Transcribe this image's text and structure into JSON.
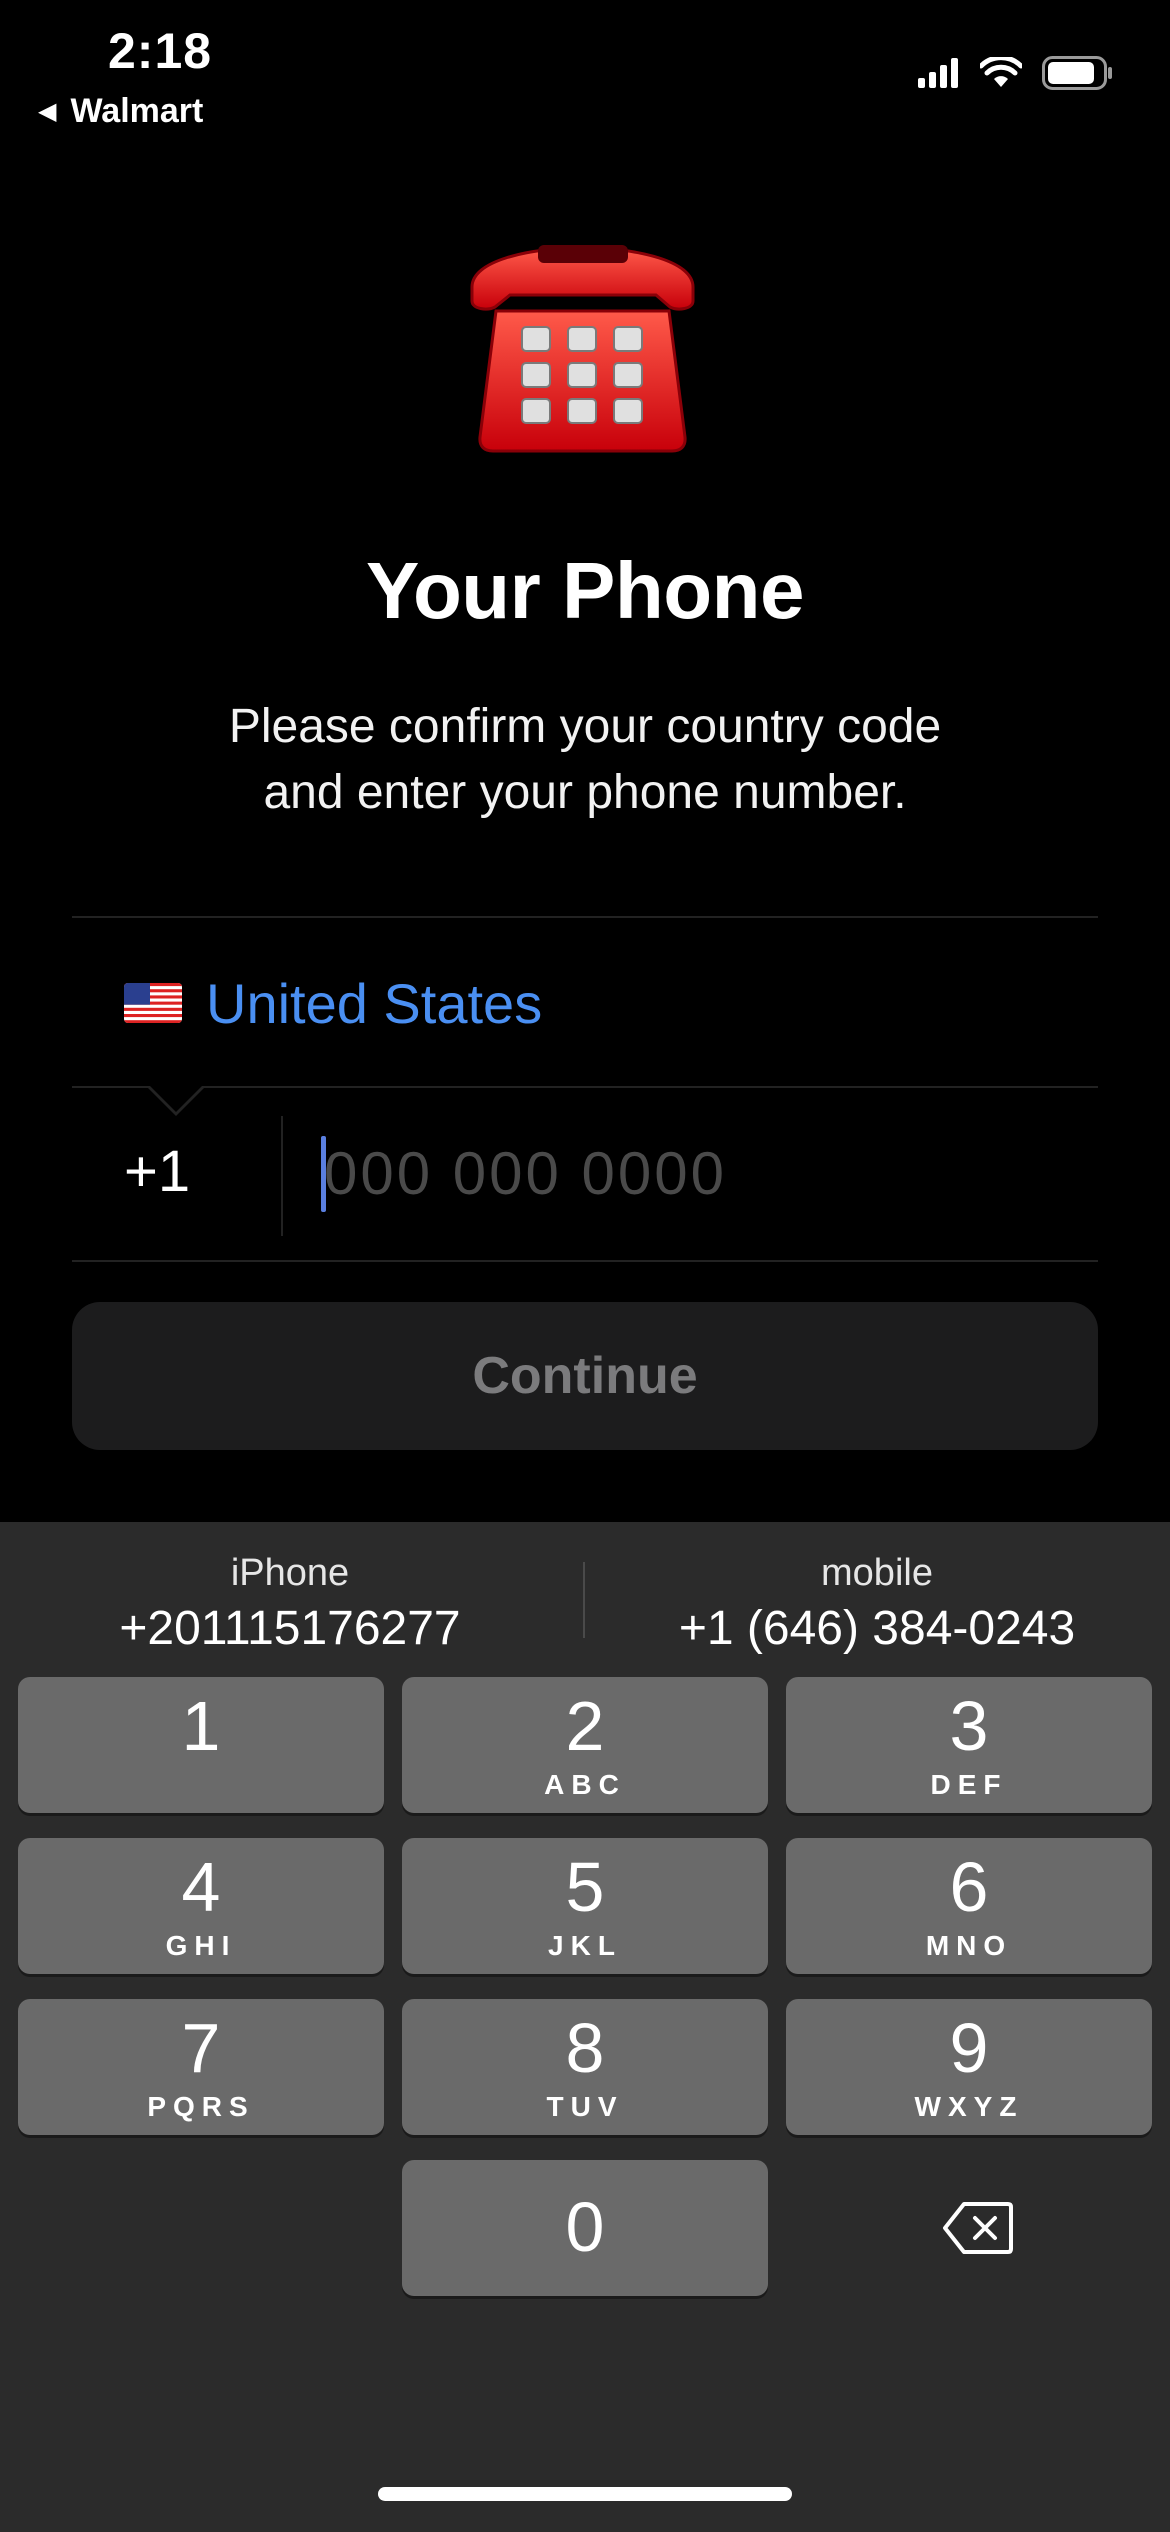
{
  "status_bar": {
    "time": "2:18",
    "back_label": "Walmart",
    "icons": [
      "signal-icon",
      "wifi-icon",
      "battery-icon"
    ]
  },
  "hero": {
    "icon": "telephone-icon",
    "title": "Your Phone",
    "subtitle_line1": "Please confirm your country code",
    "subtitle_line2": "and enter your phone number."
  },
  "form": {
    "country_flag": "us-flag-icon",
    "country_name": "United States",
    "country_code": "+1",
    "phone_value": "",
    "phone_placeholder": "000 000 0000",
    "continue_label": "Continue"
  },
  "keyboard": {
    "suggestions": [
      {
        "label": "iPhone",
        "number": "+201115176277"
      },
      {
        "label": "mobile",
        "number": "+1 (646) 384-0243"
      }
    ],
    "keys": [
      {
        "digit": "1",
        "letters": ""
      },
      {
        "digit": "2",
        "letters": "ABC"
      },
      {
        "digit": "3",
        "letters": "DEF"
      },
      {
        "digit": "4",
        "letters": "GHI"
      },
      {
        "digit": "5",
        "letters": "JKL"
      },
      {
        "digit": "6",
        "letters": "MNO"
      },
      {
        "digit": "7",
        "letters": "PQRS"
      },
      {
        "digit": "8",
        "letters": "TUV"
      },
      {
        "digit": "9",
        "letters": "WXYZ"
      },
      {
        "digit": "0",
        "letters": ""
      }
    ],
    "backspace_icon": "backspace-icon"
  },
  "colors": {
    "background": "#000000",
    "accent": "#4a8ff2",
    "key": "#6a6a6a",
    "keyboard_bg": "#2b2b2b"
  }
}
